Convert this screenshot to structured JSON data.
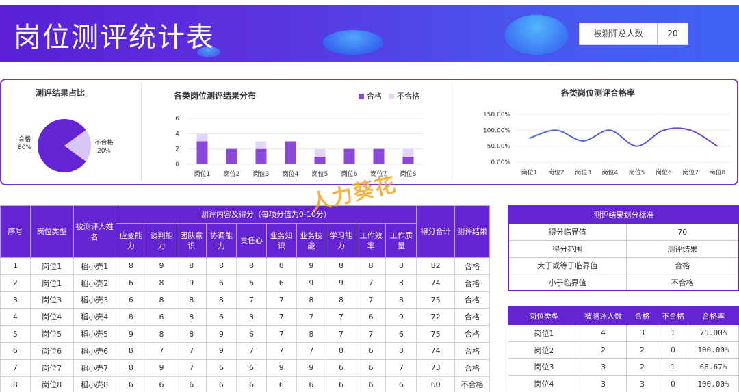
{
  "header": {
    "title": "岗位测评统计表",
    "total_label": "被测评总人数",
    "total_value": "20"
  },
  "pie": {
    "title": "测评结果占比",
    "pass_label": "合格",
    "pass_pct": "80%",
    "fail_label": "不合格",
    "fail_pct": "20%",
    "pass_color": "#6424d4",
    "fail_color": "#d7c6f5"
  },
  "chart_data": [
    {
      "type": "pie",
      "title": "测评结果占比",
      "categories": [
        "合格",
        "不合格"
      ],
      "values": [
        80,
        20
      ]
    },
    {
      "type": "bar",
      "title": "各类岗位测评结果分布",
      "categories": [
        "岗位1",
        "岗位2",
        "岗位3",
        "岗位4",
        "岗位5",
        "岗位6",
        "岗位7",
        "岗位8"
      ],
      "series": [
        {
          "name": "合格",
          "values": [
            3,
            2,
            2,
            3,
            1,
            2,
            2,
            1
          ],
          "color": "#8b47d9"
        },
        {
          "name": "不合格",
          "values": [
            1,
            0,
            1,
            0,
            1,
            0,
            0,
            1
          ],
          "color": "#e3d5f7"
        }
      ],
      "stacked": true,
      "ylim": [
        0,
        6
      ],
      "yticks": [
        "0",
        "2",
        "4",
        "6"
      ],
      "legend": "top-right",
      "grid": true
    },
    {
      "type": "line",
      "title": "各类岗位测评合格率",
      "categories": [
        "岗位1",
        "岗位2",
        "岗位3",
        "岗位4",
        "岗位5",
        "岗位6",
        "岗位7",
        "岗位8"
      ],
      "series": [
        {
          "values": [
            75,
            100,
            66.67,
            100,
            50,
            100,
            100,
            50
          ],
          "color": "#6a3cdb"
        }
      ],
      "ylim": [
        0,
        150
      ],
      "yticks": [
        "0.00%",
        "50.00%",
        "100.00%",
        "150.00%"
      ],
      "smooth": true,
      "grid": true
    }
  ],
  "main_table": {
    "headers": {
      "index": "序号",
      "type": "岗位类型",
      "name": "被测评人姓名",
      "group": "测评内容及得分（每项分值为0-10分）",
      "total": "得分合计",
      "result": "测评结果",
      "items": [
        "应变能力",
        "谈判能力",
        "团队意识",
        "协调能力",
        "责任心",
        "业务知识",
        "业务技能",
        "学习能力",
        "工作效率",
        "工作质量"
      ]
    },
    "rows": [
      {
        "idx": "1",
        "type": "岗位1",
        "name": "稻小壳1",
        "scores": [
          "8",
          "9",
          "8",
          "8",
          "8",
          "8",
          "9",
          "8",
          "8",
          "8"
        ],
        "total": "82",
        "result": "合格"
      },
      {
        "idx": "2",
        "type": "岗位1",
        "name": "稻小壳2",
        "scores": [
          "6",
          "8",
          "9",
          "6",
          "6",
          "6",
          "9",
          "9",
          "7",
          "8"
        ],
        "total": "74",
        "result": "合格"
      },
      {
        "idx": "3",
        "type": "岗位3",
        "name": "稻小壳3",
        "scores": [
          "6",
          "8",
          "8",
          "8",
          "7",
          "7",
          "8",
          "8",
          "7",
          "8"
        ],
        "total": "75",
        "result": "合格"
      },
      {
        "idx": "4",
        "type": "岗位4",
        "name": "稻小壳4",
        "scores": [
          "8",
          "6",
          "8",
          "6",
          "8",
          "7",
          "7",
          "7",
          "6",
          "9"
        ],
        "total": "72",
        "result": "合格"
      },
      {
        "idx": "5",
        "type": "岗位5",
        "name": "稻小壳5",
        "scores": [
          "9",
          "8",
          "8",
          "9",
          "6",
          "7",
          "8",
          "7",
          "7",
          "6"
        ],
        "total": "75",
        "result": "合格"
      },
      {
        "idx": "6",
        "type": "岗位6",
        "name": "稻小壳6",
        "scores": [
          "8",
          "7",
          "7",
          "9",
          "7",
          "7",
          "7",
          "8",
          "6",
          "8"
        ],
        "total": "74",
        "result": "合格"
      },
      {
        "idx": "7",
        "type": "岗位7",
        "name": "稻小壳7",
        "scores": [
          "8",
          "9",
          "7",
          "6",
          "6",
          "9",
          "9",
          "6",
          "6",
          "7"
        ],
        "total": "73",
        "result": "合格"
      },
      {
        "idx": "8",
        "type": "岗位8",
        "name": "稻小壳8",
        "scores": [
          "6",
          "6",
          "6",
          "6",
          "6",
          "6",
          "6",
          "6",
          "6",
          "6"
        ],
        "total": "60",
        "result": "不合格"
      }
    ]
  },
  "standard_table": {
    "title": "测评结果划分标准",
    "rows": [
      [
        "得分临界值",
        "70"
      ],
      [
        "得分范围",
        "测评结果"
      ],
      [
        "大于或等于临界值",
        "合格"
      ],
      [
        "小于临界值",
        "不合格"
      ]
    ]
  },
  "rate_table": {
    "headers": [
      "岗位类型",
      "被测评人数",
      "合格",
      "不合格",
      "合格率"
    ],
    "rows": [
      [
        "岗位1",
        "4",
        "3",
        "1",
        "75.00%"
      ],
      [
        "岗位2",
        "2",
        "2",
        "0",
        "100.00%"
      ],
      [
        "岗位3",
        "3",
        "2",
        "1",
        "66.67%"
      ],
      [
        "岗位4",
        "3",
        "3",
        "0",
        "100.00%"
      ]
    ]
  },
  "watermark": "人力葵花"
}
